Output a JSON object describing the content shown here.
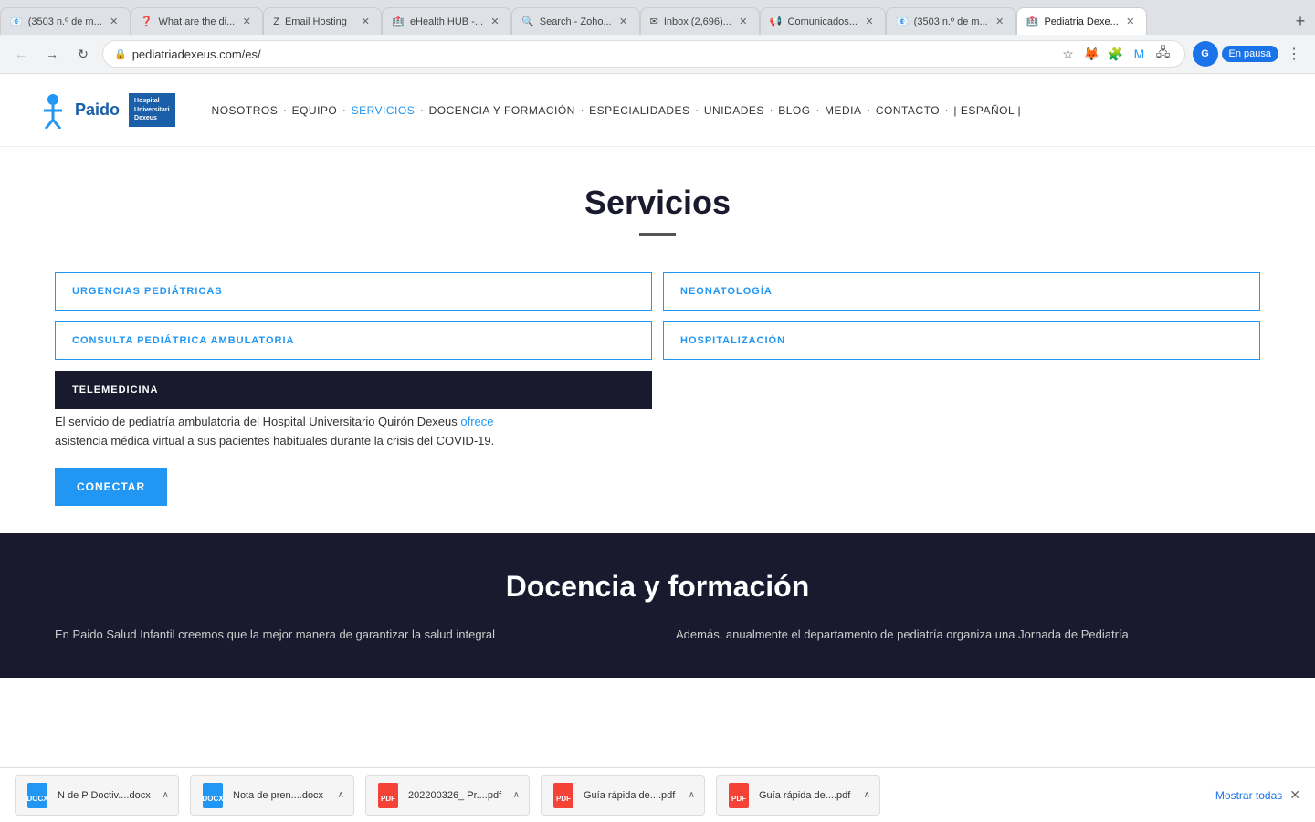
{
  "browser": {
    "tabs": [
      {
        "id": "tab1",
        "favicon": "📧",
        "title": "(3503 n.º de m...",
        "active": false,
        "favicon_color": "#e91e63"
      },
      {
        "id": "tab2",
        "favicon": "❓",
        "title": "What are the di...",
        "active": false,
        "favicon_color": "#888"
      },
      {
        "id": "tab3",
        "favicon": "Z",
        "title": "Email Hosting",
        "active": false,
        "favicon_color": "#e53935"
      },
      {
        "id": "tab4",
        "favicon": "🏥",
        "title": "eHealth HUB -...",
        "active": false,
        "favicon_color": "#4caf50"
      },
      {
        "id": "tab5",
        "favicon": "🔍",
        "title": "Search - Zoho...",
        "active": false,
        "favicon_color": "#ff9800"
      },
      {
        "id": "tab6",
        "favicon": "✉",
        "title": "Inbox (2,696)...",
        "active": false,
        "favicon_color": "#2196f3"
      },
      {
        "id": "tab7",
        "favicon": "📢",
        "title": "Comunicados...",
        "active": false,
        "favicon_color": "#9c27b0"
      },
      {
        "id": "tab8",
        "favicon": "📧",
        "title": "(3503 n.º de m...",
        "active": false,
        "favicon_color": "#e91e63"
      },
      {
        "id": "tab9",
        "favicon": "🏥",
        "title": "Pediatria Dexe...",
        "active": true,
        "favicon_color": "#2196f3"
      }
    ],
    "url": "pediatriadexeus.com/es/",
    "paused_label": "En pausa"
  },
  "nav": {
    "items": [
      {
        "label": "NOSOTROS",
        "active": false
      },
      {
        "label": "EQUIPO",
        "active": false
      },
      {
        "label": "SERVICIOS",
        "active": true
      },
      {
        "label": "DOCENCIA Y FORMACIÓN",
        "active": false
      },
      {
        "label": "ESPECIALIDADES",
        "active": false
      },
      {
        "label": "UNIDADES",
        "active": false
      },
      {
        "label": "BLOG",
        "active": false
      },
      {
        "label": "MEDIA",
        "active": false
      },
      {
        "label": "CONTACTO",
        "active": false
      },
      {
        "label": "| ESPAÑOL |",
        "active": false
      }
    ]
  },
  "main": {
    "section_title": "Servicios",
    "services": [
      {
        "label": "URGENCIAS PEDIÁTRICAS",
        "active": false,
        "col": "left"
      },
      {
        "label": "NEONATOLOGÍA",
        "active": false,
        "col": "right"
      },
      {
        "label": "CONSULTA PEDIÁTRICA AMBULATORIA",
        "active": false,
        "col": "left"
      },
      {
        "label": "HOSPITALIZACIÓN",
        "active": false,
        "col": "right"
      },
      {
        "label": "TELEMEDICINA",
        "active": true,
        "col": "left"
      }
    ],
    "telemedicina": {
      "desc_start": "El servicio de pediatría ambulatoria del ",
      "hospital_name": "Hospital Universitario Quirón Dexeus",
      "desc_link": "ofrece",
      "desc_end": " asistencia médica virtual a sus pacientes habituales durante la crisis del COVID-19.",
      "connect_label": "CONECTAR"
    },
    "dark_section": {
      "title": "Docencia y formación",
      "desc_left": "En Paido Salud Infantil creemos que la mejor manera de garantizar la salud integral",
      "desc_right": "Además, anualmente el departamento de pediatría organiza una Jornada de Pediatría"
    }
  },
  "downloads": [
    {
      "name": "N de P Doctiv....docx",
      "icon": "📄",
      "color": "#2196f3",
      "ext": "docx"
    },
    {
      "name": "Nota de pren....docx",
      "icon": "📄",
      "color": "#2196f3",
      "ext": "docx"
    },
    {
      "name": "202200326_ Pr....pdf",
      "icon": "📕",
      "color": "#f44336",
      "ext": "pdf"
    },
    {
      "name": "Guía rápida de....pdf",
      "icon": "📕",
      "color": "#f44336",
      "ext": "pdf"
    },
    {
      "name": "Guía rápida de....pdf",
      "icon": "📕",
      "color": "#f44336",
      "ext": "pdf"
    }
  ],
  "downloads_bar": {
    "show_all": "Mostrar todas",
    "close": "✕"
  }
}
